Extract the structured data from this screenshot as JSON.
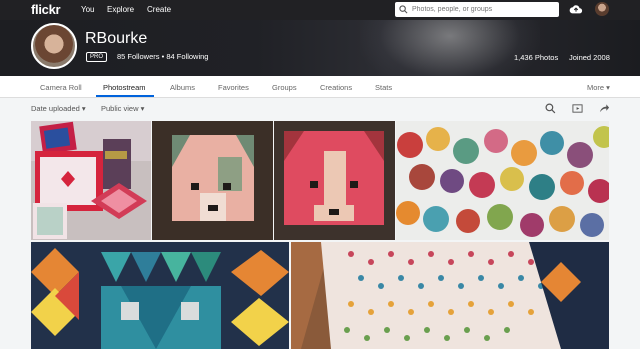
{
  "topnav": {
    "logo": "flickr",
    "links": [
      "You",
      "Explore",
      "Create"
    ],
    "search_placeholder": "Photos, people, or groups",
    "icons": [
      "search-icon",
      "upload-cloud-icon",
      "user-avatar"
    ]
  },
  "profile": {
    "name": "RBourke",
    "badge": "PRO",
    "followers": "85 Followers",
    "following": "84 Following",
    "photos": "1,436 Photos",
    "joined": "Joined 2008"
  },
  "tabs": [
    "Camera Roll",
    "Photostream",
    "Albums",
    "Favorites",
    "Groups",
    "Creations",
    "Stats",
    "More ▾"
  ],
  "active_tab": "Photostream",
  "filters": {
    "sort": "Date uploaded ▾",
    "visibility": "Public view ▾",
    "icons": [
      "search-icon",
      "slideshow-icon",
      "share-icon"
    ]
  },
  "colors": {
    "topbar": "#212124",
    "accent": "#0063dc",
    "background": "#f3f5f6"
  },
  "photos": [
    "Red and pink quilted items with a book",
    "Quilted dog face with green patch",
    "Quilted pink dog face",
    "Quilt with colorful circles",
    "Star and basket quilt on navy",
    "Polka dot quilt on wooden floor"
  ]
}
